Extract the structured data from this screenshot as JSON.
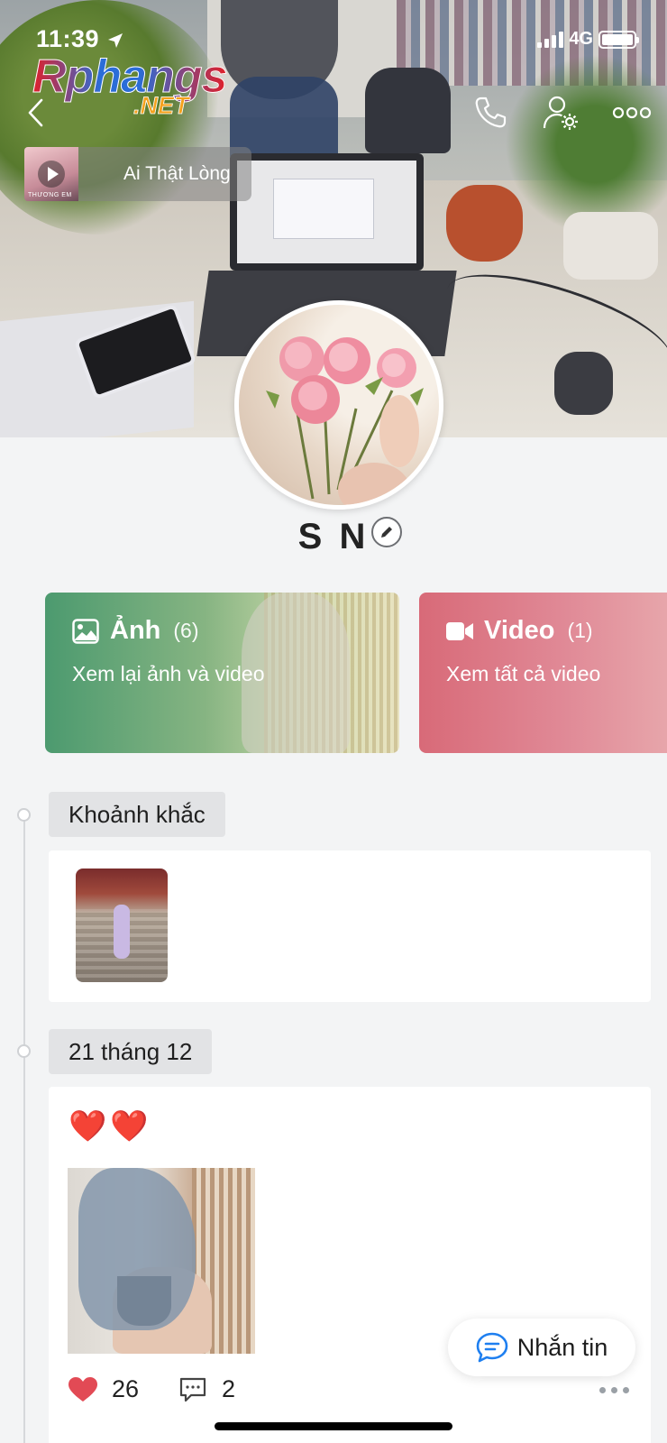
{
  "status_bar": {
    "time": "11:39",
    "network": "4G"
  },
  "watermark": {
    "brand": "Rphangs",
    "suffix": ".NET"
  },
  "music": {
    "title": "Ai Thật Lòng",
    "thumb_label": "THƯƠNG EM"
  },
  "profile": {
    "name": "S N"
  },
  "cards": {
    "photo": {
      "label": "Ảnh",
      "count": "(6)",
      "subtitle": "Xem lại ảnh và video"
    },
    "video": {
      "label": "Video",
      "count": "(1)",
      "subtitle": "Xem tất cả video"
    }
  },
  "timeline": {
    "moments_label": "Khoảnh khắc",
    "post_date": "21 tháng 12",
    "post": {
      "caption": "❤️❤️",
      "likes": "26",
      "comments": "2"
    }
  },
  "chat_button": {
    "label": "Nhắn tin"
  },
  "colors": {
    "photo_card": "#4c9a6f",
    "video_card": "#d86a78",
    "chat_icon": "#1e7ff0",
    "like_heart": "#e24a55"
  }
}
